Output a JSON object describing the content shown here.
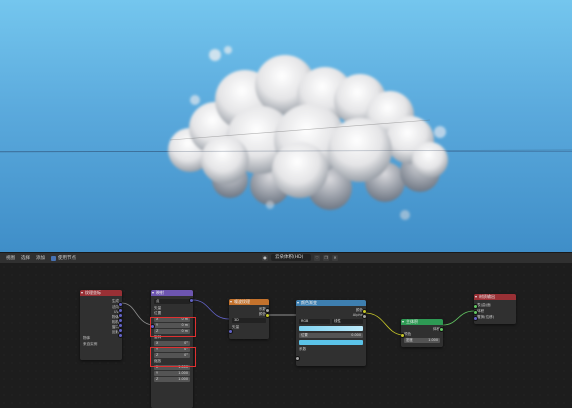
{
  "viewport": {
    "sky_top": "#74c6ee",
    "sky_bottom": "#3f8ec8",
    "cloud_color": "#f2f2f2"
  },
  "editor_header": {
    "menu": [
      "视图",
      "选择",
      "添加",
      "节点"
    ],
    "use_nodes_label": "使用节点",
    "material_name": "云朵体积(HD)"
  },
  "nodes": {
    "texcoord": {
      "title": "纹理坐标",
      "outputs": [
        "生成",
        "法向",
        "UV",
        "物体",
        "相机",
        "窗口",
        "反射"
      ],
      "object_label": "物体",
      "from_instancer": "来自实例"
    },
    "mapping": {
      "title": "映射",
      "type_value": "点",
      "vector_label": "矢量",
      "location_label": "位置",
      "loc_values": [
        "0 m",
        "0 m",
        "0 m"
      ],
      "rotation_label": "旋转",
      "rot_values": [
        "0°",
        "0°",
        "0°"
      ],
      "scale_label": "缩放",
      "scale_values": [
        "1.000",
        "1.000",
        "1.000"
      ],
      "output_label": "矢量"
    },
    "noise": {
      "title": "噪波纹理",
      "dim": "3D",
      "outputs": [
        "系数",
        "颜色"
      ],
      "inputs": [
        "矢量"
      ]
    },
    "colorramp": {
      "title": "颜色渐变",
      "outputs": [
        "颜色",
        "Alpha"
      ],
      "mode_left": "RGB",
      "mode_right": "线性",
      "pos_label": "位置",
      "pos_value": "0.000",
      "input_label": "系数"
    },
    "volume": {
      "title": "主体积",
      "output": "体积",
      "color_label": "颜色",
      "density_label": "密度",
      "density_value": "1.000"
    },
    "matoutput": {
      "title": "材质输出",
      "inputs": [
        "表(曲)面",
        "体积",
        "置换(位移)"
      ]
    }
  }
}
